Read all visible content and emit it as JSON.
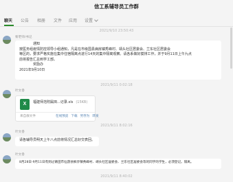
{
  "window": {
    "title": "信工系辅导员工作群"
  },
  "tabs": [
    {
      "label": "聊天"
    },
    {
      "label": "公告"
    },
    {
      "label": "相册"
    },
    {
      "label": "文件"
    },
    {
      "label": "应用"
    },
    {
      "label": "设置"
    }
  ],
  "messages": {
    "ts1": "2021/9/10 23:50:43",
    "msg1": {
      "sender": "黎老师/书记",
      "lines": [
        "通知",
        "按医务组疫情防控领导小组通知，凡是在市级国县病房镇秀峰村、靖头社区居委会、兰东社区居委会",
        "等区的，要求严格实施在集中住宿隔离点进行14天的集中隔离观察。请各系做好摸排工作，并于9月11日上午九点",
        "前将报告汇总到学工部。",
        "奖励办",
        "2021年9月10日"
      ]
    },
    "ts2": "2021/9/11 0:02:18",
    "msg2": {
      "sender": "叶文香",
      "file_icon": "X",
      "file_name": "福建师范附属田...记录.xls",
      "file_size": "(15KB)",
      "footer_left": "来自群文件",
      "actions": [
        "在线预览",
        "下载",
        "另存为",
        "转发"
      ]
    },
    "ts3": "2021/9/11 8:02:16",
    "msg3": {
      "sender": "叶文香",
      "text": "请各辅导员明天上午八点前将情况汇总好交表回。"
    },
    "msg4": {
      "sender": "叶文香",
      "text": "8月28日-9月11日有到过莆田市仙游县枫亭镇秀峰村、靖头社区居委会、兰东社区居委会等的同学的学生，必须登记。隔离。"
    },
    "ts4": "2021/9/11 8:40:02"
  }
}
